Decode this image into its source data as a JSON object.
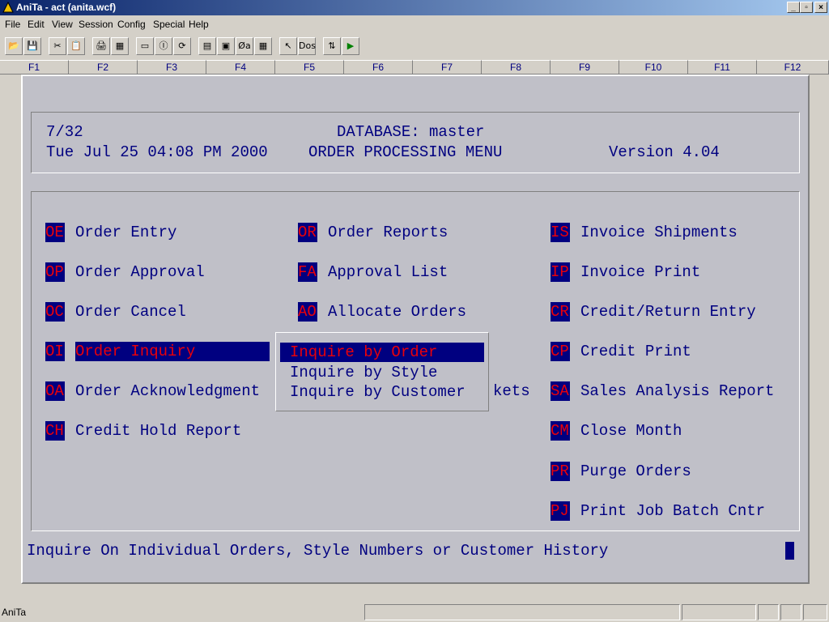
{
  "window": {
    "title": "AniTa - act (anita.wcf)",
    "min_label": "_",
    "max_label": "▫",
    "close_label": "×"
  },
  "menubar": {
    "items": [
      "File",
      "Edit",
      "View",
      "Session",
      "Config",
      "Special",
      "Help"
    ]
  },
  "toolbar": {
    "glyphs": [
      "📂",
      "💾",
      "✂",
      "📋",
      "🖨",
      "▦",
      "▭",
      "Ⓘ",
      "⟳",
      "▤",
      "▣",
      "Øa",
      "▦",
      "↖",
      "Dos",
      "⇅",
      "▶"
    ]
  },
  "fkeys": [
    "F1",
    "F2",
    "F3",
    "F4",
    "F5",
    "F6",
    "F7",
    "F8",
    "F9",
    "F10",
    "F11",
    "F12"
  ],
  "header": {
    "page": "7/32",
    "database": "DATABASE: master",
    "datetime": "Tue Jul 25 04:08 PM 2000",
    "menu_title": "ORDER PROCESSING MENU",
    "version": "Version 4.04"
  },
  "menu": {
    "col1": [
      {
        "code": "OE",
        "label": "Order Entry"
      },
      {
        "code": "OP",
        "label": "Order Approval"
      },
      {
        "code": "OC",
        "label": "Order Cancel"
      },
      {
        "code": "OI",
        "label": "Order Inquiry"
      },
      {
        "code": "OA",
        "label": "Order Acknowledgment"
      },
      {
        "code": "CH",
        "label": "Credit Hold Report"
      }
    ],
    "col2": [
      {
        "code": "OR",
        "label": "Order Reports"
      },
      {
        "code": "FA",
        "label": "Approval List"
      },
      {
        "code": "AO",
        "label": "Allocate Orders"
      },
      {
        "code": "",
        "label": ""
      },
      {
        "code": "",
        "label": "kets"
      }
    ],
    "col3": [
      {
        "code": "IS",
        "label": "Invoice Shipments"
      },
      {
        "code": "IP",
        "label": "Invoice Print"
      },
      {
        "code": "CR",
        "label": "Credit/Return Entry"
      },
      {
        "code": "CP",
        "label": "Credit Print"
      },
      {
        "code": "SA",
        "label": "Sales Analysis Report"
      },
      {
        "code": "CM",
        "label": "Close Month"
      },
      {
        "code": "PR",
        "label": "Purge Orders"
      },
      {
        "code": "PJ",
        "label": "Print Job Batch Cntr"
      }
    ]
  },
  "popup": {
    "items": [
      "Inquire by Order",
      "Inquire by Style",
      "Inquire by Customer"
    ]
  },
  "status_line": "Inquire On Individual Orders, Style Numbers or Customer History",
  "statusbar": {
    "text": "AniTa"
  },
  "colors": {
    "terminal_bg": "#c0c0c8",
    "text": "#000080",
    "code_fg": "#e8000a",
    "code_bg": "#000080"
  }
}
